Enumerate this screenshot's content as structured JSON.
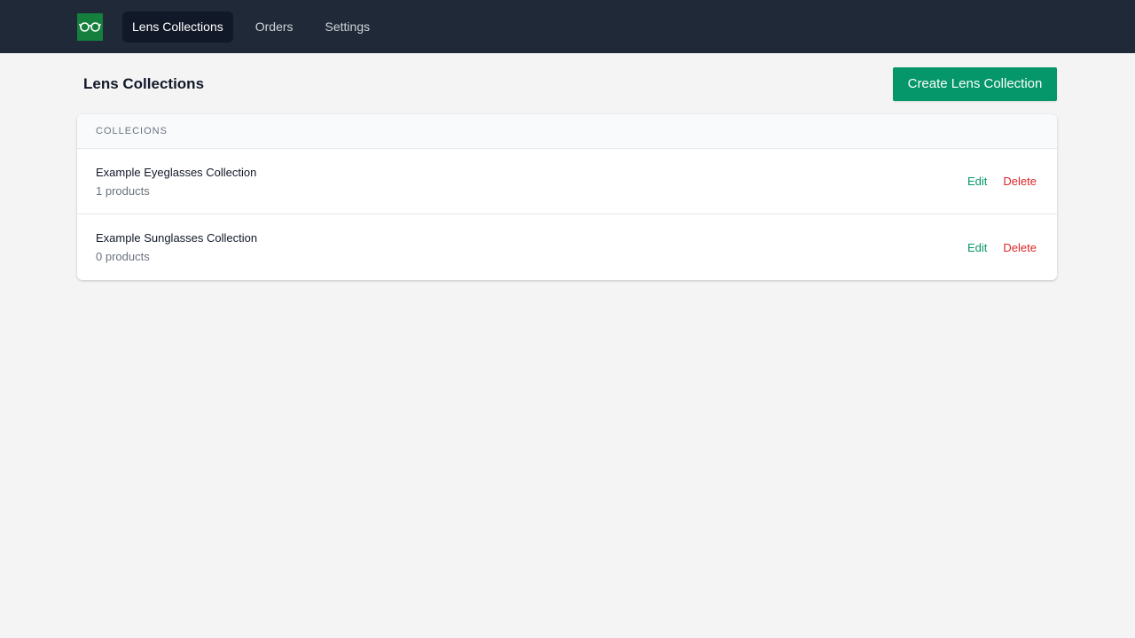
{
  "nav": {
    "logo_icon": "glasses-icon",
    "items": [
      {
        "label": "Lens Collections",
        "active": true
      },
      {
        "label": "Orders",
        "active": false
      },
      {
        "label": "Settings",
        "active": false
      }
    ]
  },
  "header": {
    "title": "Lens Collections",
    "create_label": "Create Lens Collection"
  },
  "table": {
    "header_label": "COLLECIONS",
    "rows": [
      {
        "name": "Example Eyeglasses Collection",
        "count": "1 products",
        "edit": "Edit",
        "delete": "Delete"
      },
      {
        "name": "Example Sunglasses Collection",
        "count": "0 products",
        "edit": "Edit",
        "delete": "Delete"
      }
    ]
  },
  "colors": {
    "nav_bg": "#1f2937",
    "accent": "#059669",
    "danger": "#dc2626",
    "logo_bg": "#15803d"
  }
}
